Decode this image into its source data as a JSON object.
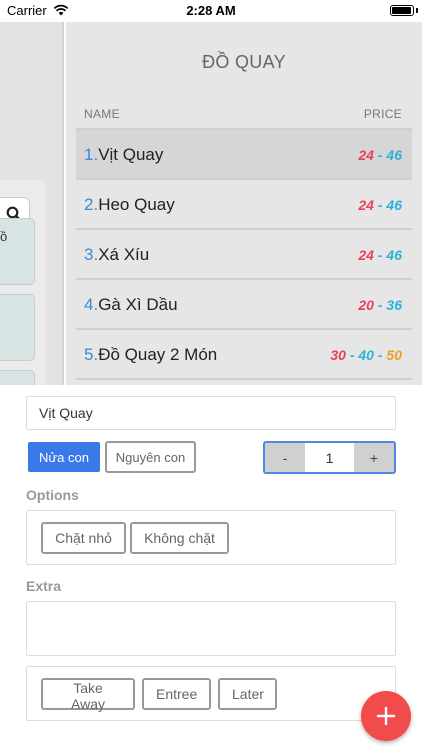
{
  "status_bar": {
    "carrier": "Carrier",
    "time": "2:28 AM",
    "battery_level": 0.95
  },
  "left_pane": {
    "tiles": [
      {
        "text": "ồ"
      },
      {
        "text": ""
      },
      {
        "text": ""
      }
    ]
  },
  "category": {
    "title": "ĐỒ QUAY",
    "col_name": "NAME",
    "col_price": "PRICE"
  },
  "menu_items": [
    {
      "num": "1.",
      "name": "Vịt Quay",
      "prices": [
        {
          "value": "24",
          "color": "#e8415a"
        },
        {
          "value": "46",
          "color": "#2fb0d8"
        }
      ],
      "selected": true
    },
    {
      "num": "2.",
      "name": "Heo Quay",
      "prices": [
        {
          "value": "24",
          "color": "#e8415a"
        },
        {
          "value": "46",
          "color": "#2fb0d8"
        }
      ],
      "selected": false
    },
    {
      "num": "3.",
      "name": "Xá Xíu",
      "prices": [
        {
          "value": "24",
          "color": "#e8415a"
        },
        {
          "value": "46",
          "color": "#2fb0d8"
        }
      ],
      "selected": false
    },
    {
      "num": "4.",
      "name": "Gà Xì Dầu",
      "prices": [
        {
          "value": "20",
          "color": "#e8415a"
        },
        {
          "value": "36",
          "color": "#2fb0d8"
        }
      ],
      "selected": false
    },
    {
      "num": "5.",
      "name": "Đồ Quay 2 Món",
      "prices": [
        {
          "value": "30",
          "color": "#e8415a"
        },
        {
          "value": "40",
          "color": "#2fb0d8"
        },
        {
          "value": "50",
          "color": "#f0a020"
        }
      ],
      "selected": false
    }
  ],
  "price_separator": " - ",
  "detail": {
    "item_name": "Vịt Quay",
    "size_options": [
      {
        "label": "Nửa con",
        "active": true
      },
      {
        "label": "Nguyên con",
        "active": false
      }
    ],
    "quantity": {
      "minus": "-",
      "value": "1",
      "plus": "+"
    },
    "options_label": "Options",
    "options": [
      "Chặt nhỏ",
      "Không chặt"
    ],
    "extra_label": "Extra",
    "extra_value": "",
    "order_types": [
      "Take Away",
      "Entree",
      "Later"
    ]
  },
  "colors": {
    "accent": "#3a79e8",
    "fab": "#f24b4b",
    "number": "#3a8ad6"
  }
}
